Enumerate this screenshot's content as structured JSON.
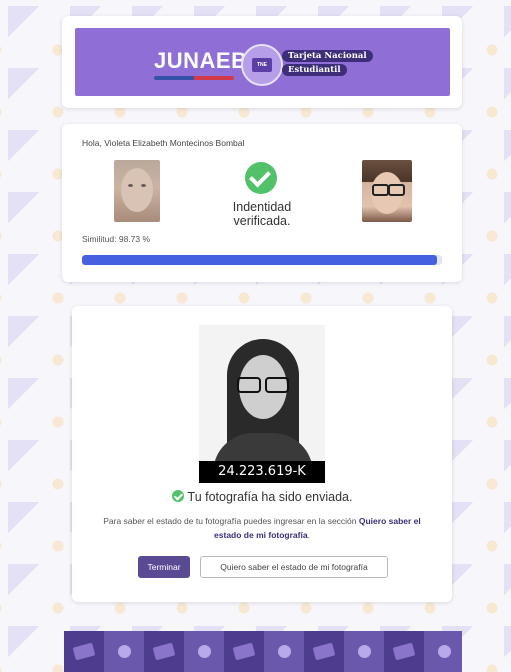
{
  "header": {
    "logo_text": "JUNAEB",
    "tne_icon_text": "TNE",
    "tne_line1": "Tarjeta Nacional",
    "tne_line2": "Estudiantil",
    "colors": {
      "banner": "#8f6fd6",
      "pill": "#3e2d78"
    }
  },
  "verification": {
    "greeting": "Hola, Violeta Elizabeth Montecinos Bombal",
    "status_line1": "Indentidad",
    "status_line2": "verificada.",
    "similarity_label": "Similitud: 98.73 %",
    "similarity_fraction": 0.9873,
    "status_icon": "check-circle-icon",
    "colors": {
      "check": "#52c26a",
      "progress": "#4560e0"
    }
  },
  "result": {
    "rut": "24.223.619-K",
    "sent_message": "Tu fotografía ha sido enviada.",
    "info_prefix": "Para saber el estado de tu fotografía puedes ingresar en la sección ",
    "info_bold": "Quiero saber el estado de mi fotografía",
    "info_suffix": ".",
    "finish_button": "Terminar",
    "status_button": "Quiero saber el estado de mi fotografía"
  },
  "footer": {
    "pattern": [
      "card-icon",
      "circle-icon",
      "card-icon",
      "circle-icon",
      "card-icon",
      "circle-icon",
      "card-icon",
      "circle-icon",
      "card-icon",
      "circle-icon"
    ],
    "colors": {
      "strip": "#5e4b9e"
    }
  }
}
